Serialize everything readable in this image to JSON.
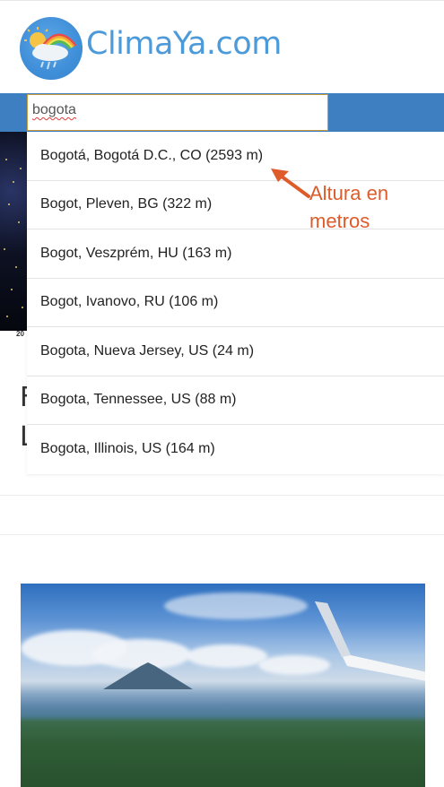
{
  "app": {
    "logo_text": "ClimaYa.com"
  },
  "search": {
    "value": "bogota"
  },
  "dropdown": {
    "items": [
      "Bogotá, Bogotá D.C., CO (2593 m)",
      "Bogot, Pleven, BG (322 m)",
      "Bogot, Veszprém, HU (163 m)",
      "Bogot, Ivanovo, RU (106 m)",
      "Bogota, Nueva Jersey, US (24 m)",
      "Bogota, Tennessee, US (88 m)",
      "Bogota, Illinois, US (164 m)"
    ]
  },
  "annotation": {
    "text": "Altura en metros",
    "color": "#de5b2a"
  },
  "background": {
    "sat_label": "20",
    "partial_letters": [
      "F",
      "L"
    ]
  },
  "colors": {
    "brand": "#4c9ad9",
    "bar": "#3d7fc1",
    "input_border": "#c79a3c"
  }
}
